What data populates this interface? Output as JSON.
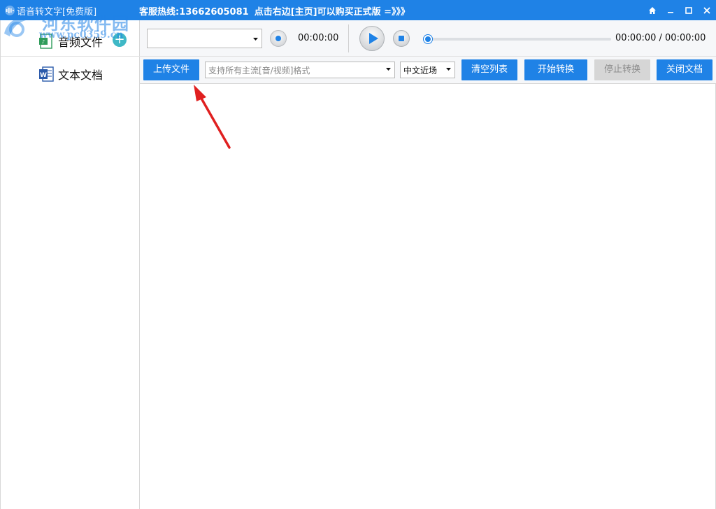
{
  "titlebar": {
    "app_title": "语音转文字[免费版]",
    "hotline": "客服热线:13662605081",
    "buy_hint": "点击右边[主页]可以购买正式版 =》》》",
    "controls": [
      "home-icon",
      "minimize-icon",
      "maximize-icon",
      "close-icon"
    ]
  },
  "watermark": {
    "text": "河东软件园",
    "url": "www.pc0359.cn"
  },
  "sidebar": {
    "items": [
      {
        "label": "音频文件",
        "icon": "audio-file-icon"
      },
      {
        "label": "文本文档",
        "icon": "word-document-icon"
      }
    ],
    "add_label": "+"
  },
  "player": {
    "device_value": "",
    "record_time": "00:00:00",
    "position_time": "00:00:00 / 00:00:00",
    "progress": 0
  },
  "toolbar": {
    "upload_label": "上传文件",
    "format_placeholder": "支持所有主流[音/视频]格式",
    "language_value": "中文近场",
    "clear_label": "清空列表",
    "start_label": "开始转换",
    "stop_label": "停止转换",
    "close_label": "关闭文档"
  },
  "colors": {
    "accent": "#1f82e6",
    "disabled": "#d6d6d6",
    "annotation_arrow": "#e02020"
  }
}
